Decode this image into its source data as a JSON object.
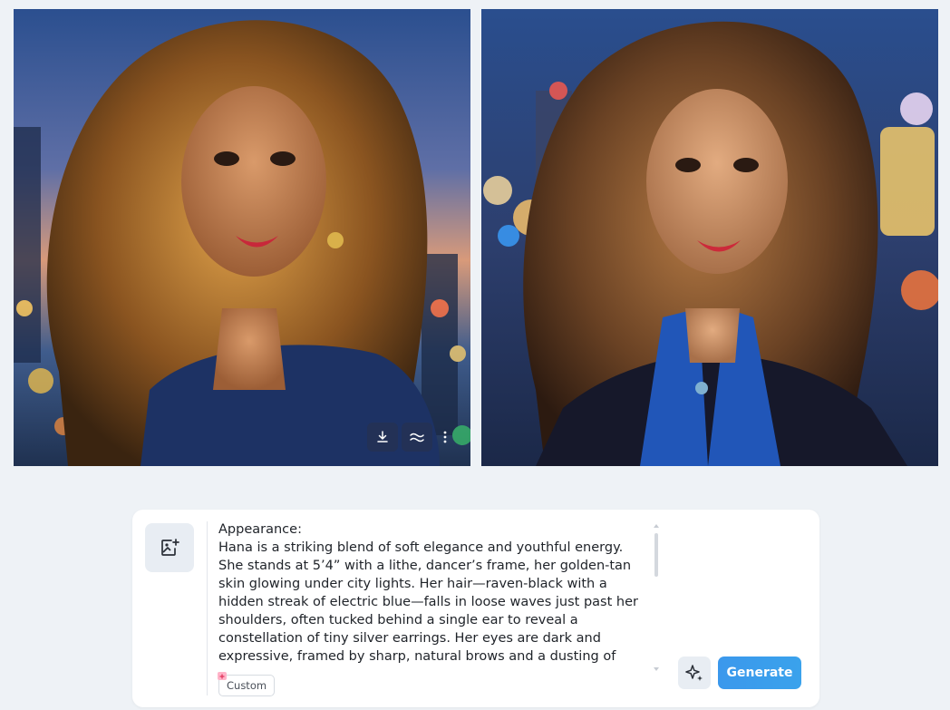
{
  "images": [
    {
      "description_icon": "portrait-image",
      "actions": [
        {
          "icon": "download-icon"
        },
        {
          "icon": "variation-icon"
        },
        {
          "icon": "more-vertical-icon"
        }
      ]
    },
    {
      "description_icon": "portrait-image"
    }
  ],
  "composer": {
    "upload_icon": "image-add-icon",
    "prompt_text": "Appearance:\nHana is a striking blend of soft elegance and youthful energy. She stands at 5’4” with a lithe, dancer’s frame, her golden-tan skin glowing under city lights. Her hair—raven-black with a hidden streak of electric blue—falls in loose waves just past her shoulders, often tucked behind a single ear to reveal a constellation of tiny silver earrings. Her eyes are dark and expressive, framed by sharp, natural brows and a dusting of freckles across her nose. She dresses in modern fashion with",
    "tag_label": "Custom",
    "enhance_icon": "sparkle-icon",
    "generate_label": "Generate"
  },
  "colors": {
    "accent": "#3b9cec",
    "background": "#eef2f6"
  }
}
